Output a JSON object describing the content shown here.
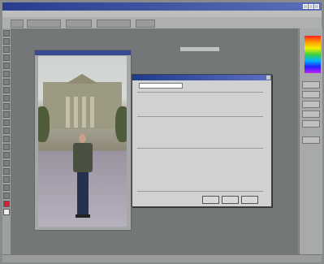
{
  "app": {
    "title": ""
  },
  "menu": [],
  "dialog": {
    "title": "",
    "buttons": []
  },
  "colors": {
    "titlebar": "#2a3c8c",
    "workspace": "#737777",
    "dialog_bg": "#d0d2d2"
  },
  "icons": {
    "minimize": "minimize-icon",
    "maximize": "maximize-icon",
    "close": "close-icon",
    "color_swatches": "color-swatches-icon"
  }
}
